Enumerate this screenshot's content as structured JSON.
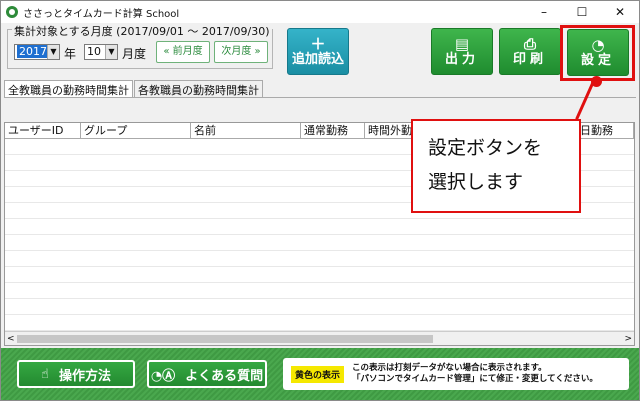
{
  "window": {
    "title": "ささっとタイムカード計算 School",
    "minimize": "–",
    "maximize": "☐",
    "close": "✕"
  },
  "period": {
    "legend": "集計対象とする月度 (2017/09/01 ～ 2017/09/30)",
    "year": "2017",
    "year_unit": "年",
    "month": "10",
    "month_unit": "月度",
    "prev": "« 前月度",
    "next": "次月度 »",
    "arrow": "▼"
  },
  "toolbar": {
    "add": {
      "icon": "＋",
      "label": "追加読込"
    },
    "output": {
      "icon": "▤",
      "label": "出力"
    },
    "print": {
      "icon": "⎙",
      "label": "印刷"
    },
    "settings": {
      "icon": "◔",
      "label": "設定"
    }
  },
  "tabs": [
    "全教職員の勤務時間集計",
    "各教職員の勤務時間集計"
  ],
  "grid": {
    "headers": [
      "ユーザーID",
      "グループ",
      "名前",
      "通常勤務",
      "時間外勤",
      "",
      "",
      "",
      "日勤務"
    ],
    "scroll_left": "<",
    "scroll_right": ">"
  },
  "callout": {
    "line1": "設定ボタンを",
    "line2": "選択します"
  },
  "footer": {
    "howto_icon": "☝",
    "howto": "操作方法",
    "faq_icon": "◔Ⓐ",
    "faq": "よくある質問",
    "yellow_label": "黄色の表示",
    "notice1": "この表示は打刻データがない場合に表示されます。",
    "notice2": "「パソコンでタイムカード管理」にて修正・変更してください。"
  }
}
